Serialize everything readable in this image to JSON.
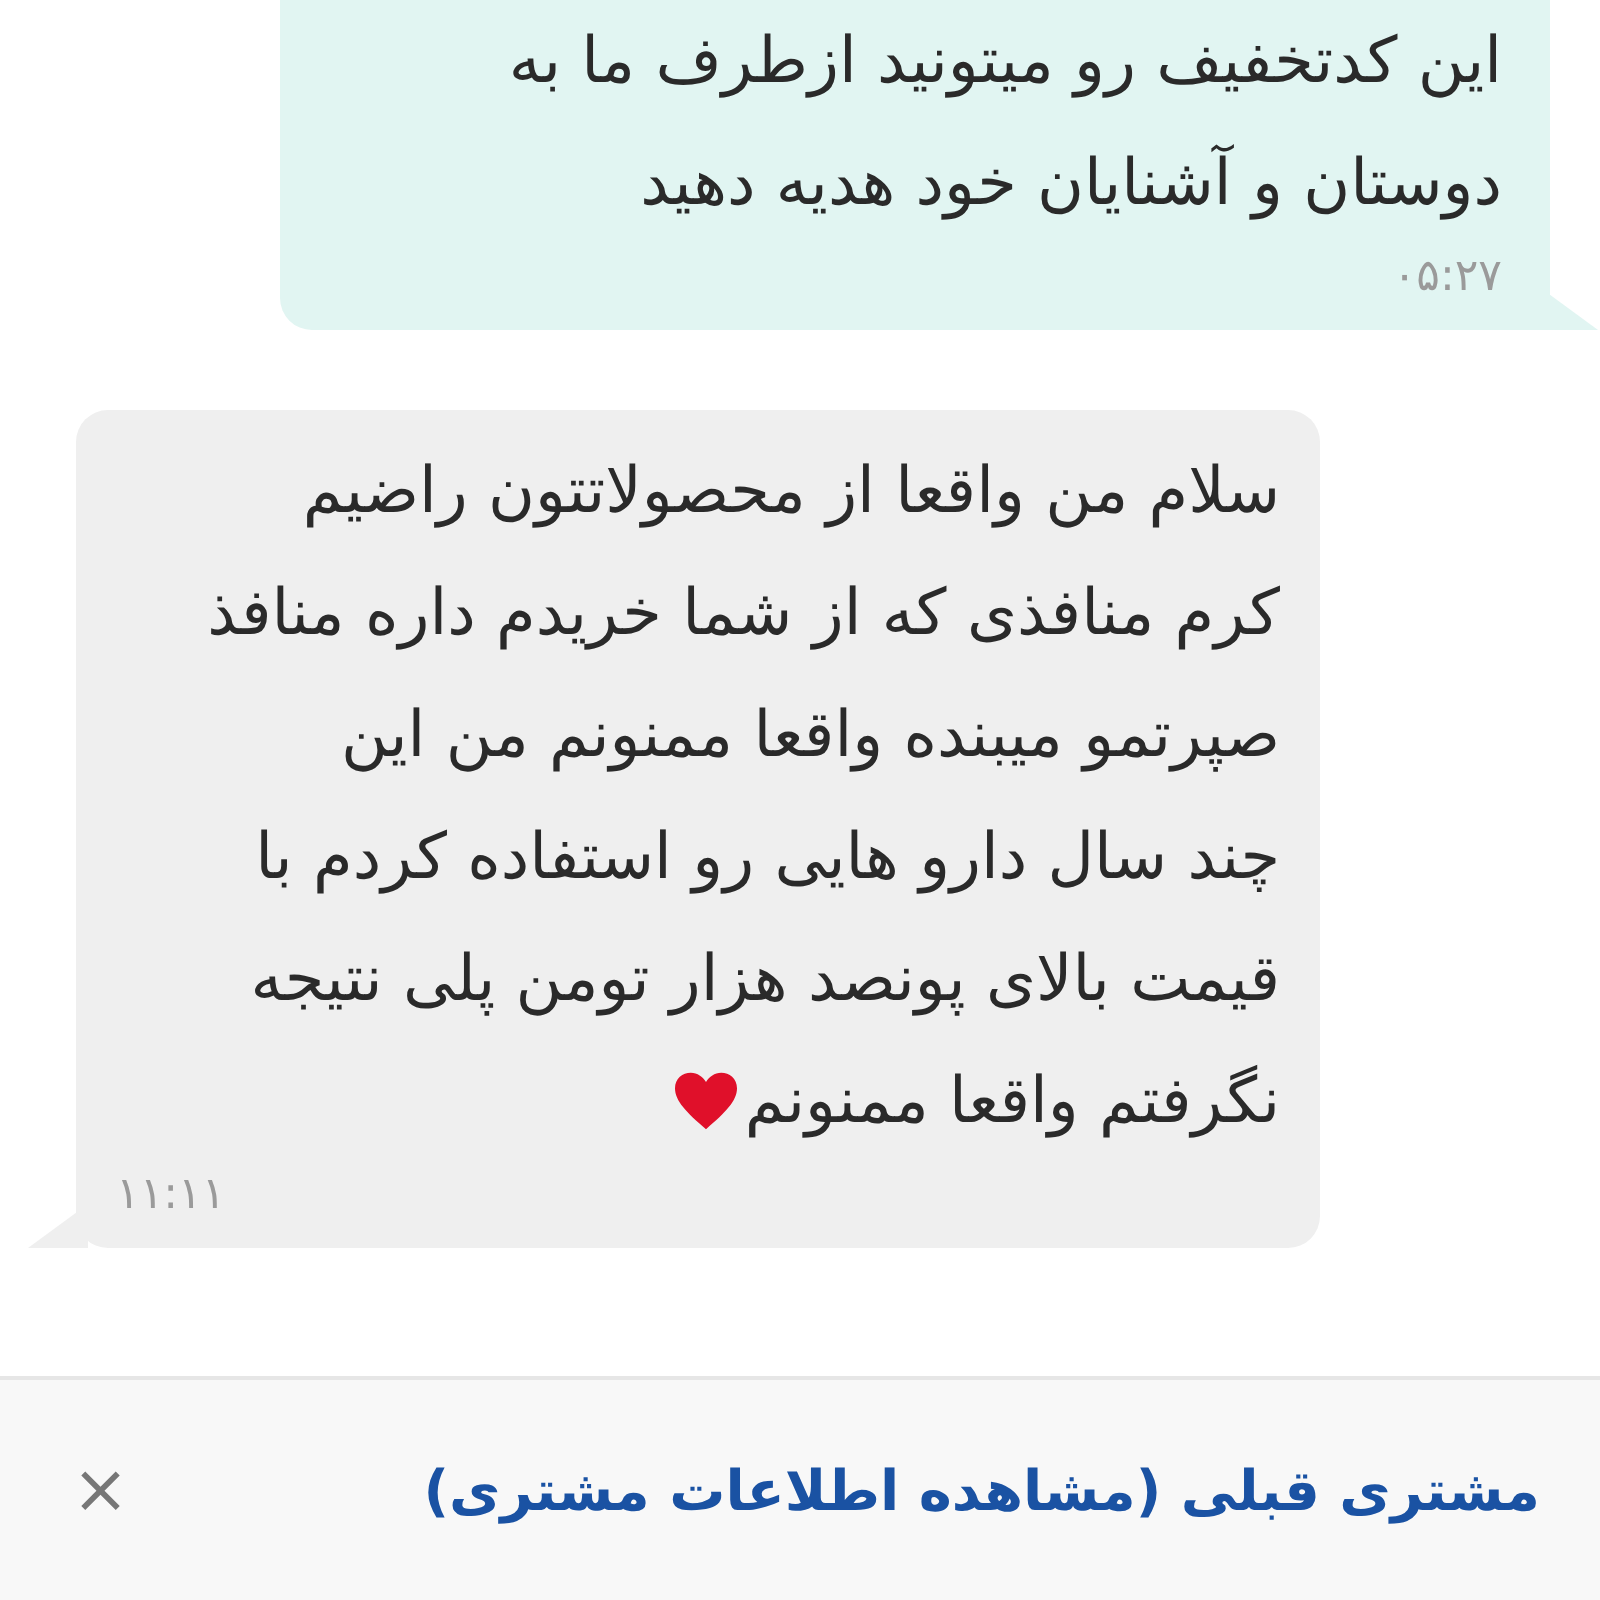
{
  "messages": [
    {
      "kind": "outgoing",
      "lines": [
        "این کدتخفیف رو میتونید ازطرف ما به",
        "دوستان و آشنایان خود هدیه دهید"
      ],
      "time": "۰۵:۲۷",
      "heart": false
    },
    {
      "kind": "incoming",
      "lines": [
        "سلام من واقعا از محصولاتتون راضیم",
        "کرم منافذی که از شما خریدم داره منافذ",
        "صپرتمو میبنده واقعا ممنونم من این",
        "چند سال دارو هایی رو استفاده کردم با",
        "قیمت بالای پونصد هزار تومن پلی نتیجه",
        "نگرفتم واقعا ممنونم"
      ],
      "time": "۱۱:۱۱",
      "heart": true
    }
  ],
  "bottom_bar": {
    "title": "مشتری قبلی (مشاهده اطلاعات مشتری)",
    "close": "×"
  }
}
